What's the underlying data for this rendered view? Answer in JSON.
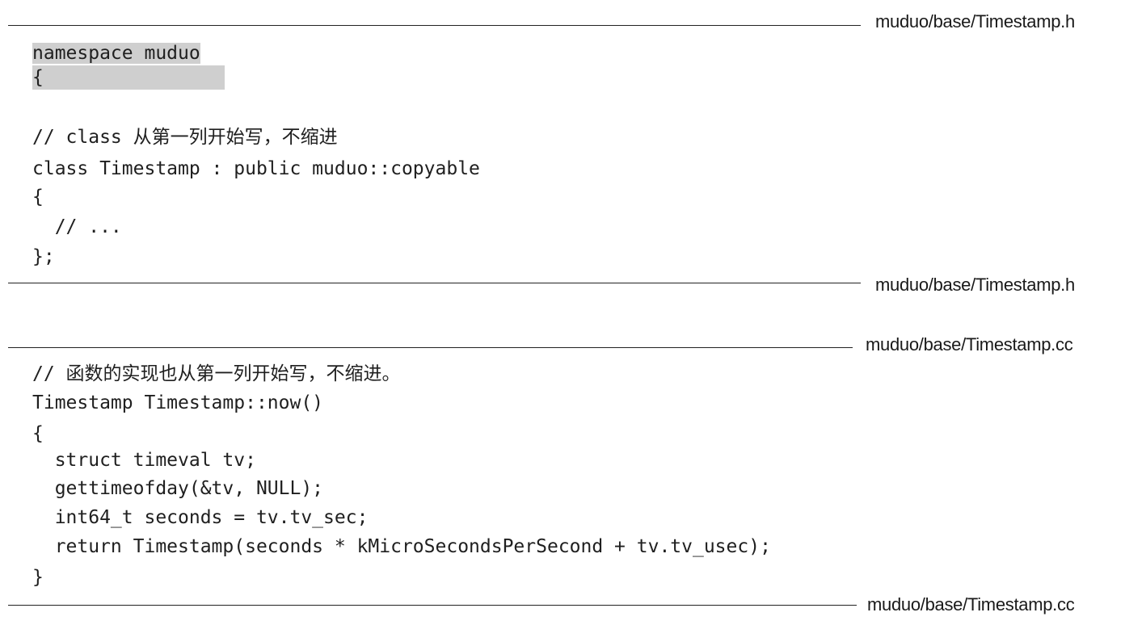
{
  "listings": [
    {
      "file": "muduo/base/Timestamp.h",
      "lines": [
        "namespace muduo",
        "{",
        "",
        "// class 从第一列开始写，不缩进",
        "class Timestamp : public muduo::copyable",
        "{",
        "  // ...",
        "};"
      ]
    },
    {
      "file": "muduo/base/Timestamp.cc",
      "lines": [
        "// 函数的实现也从第一列开始写，不缩进。",
        "Timestamp Timestamp::now()",
        "{",
        "  struct timeval tv;",
        "  gettimeofday(&tv, NULL);",
        "  int64_t seconds = tv.tv_sec;",
        "  return Timestamp(seconds * kMicroSecondsPerSecond + tv.tv_usec);",
        "}"
      ]
    }
  ]
}
